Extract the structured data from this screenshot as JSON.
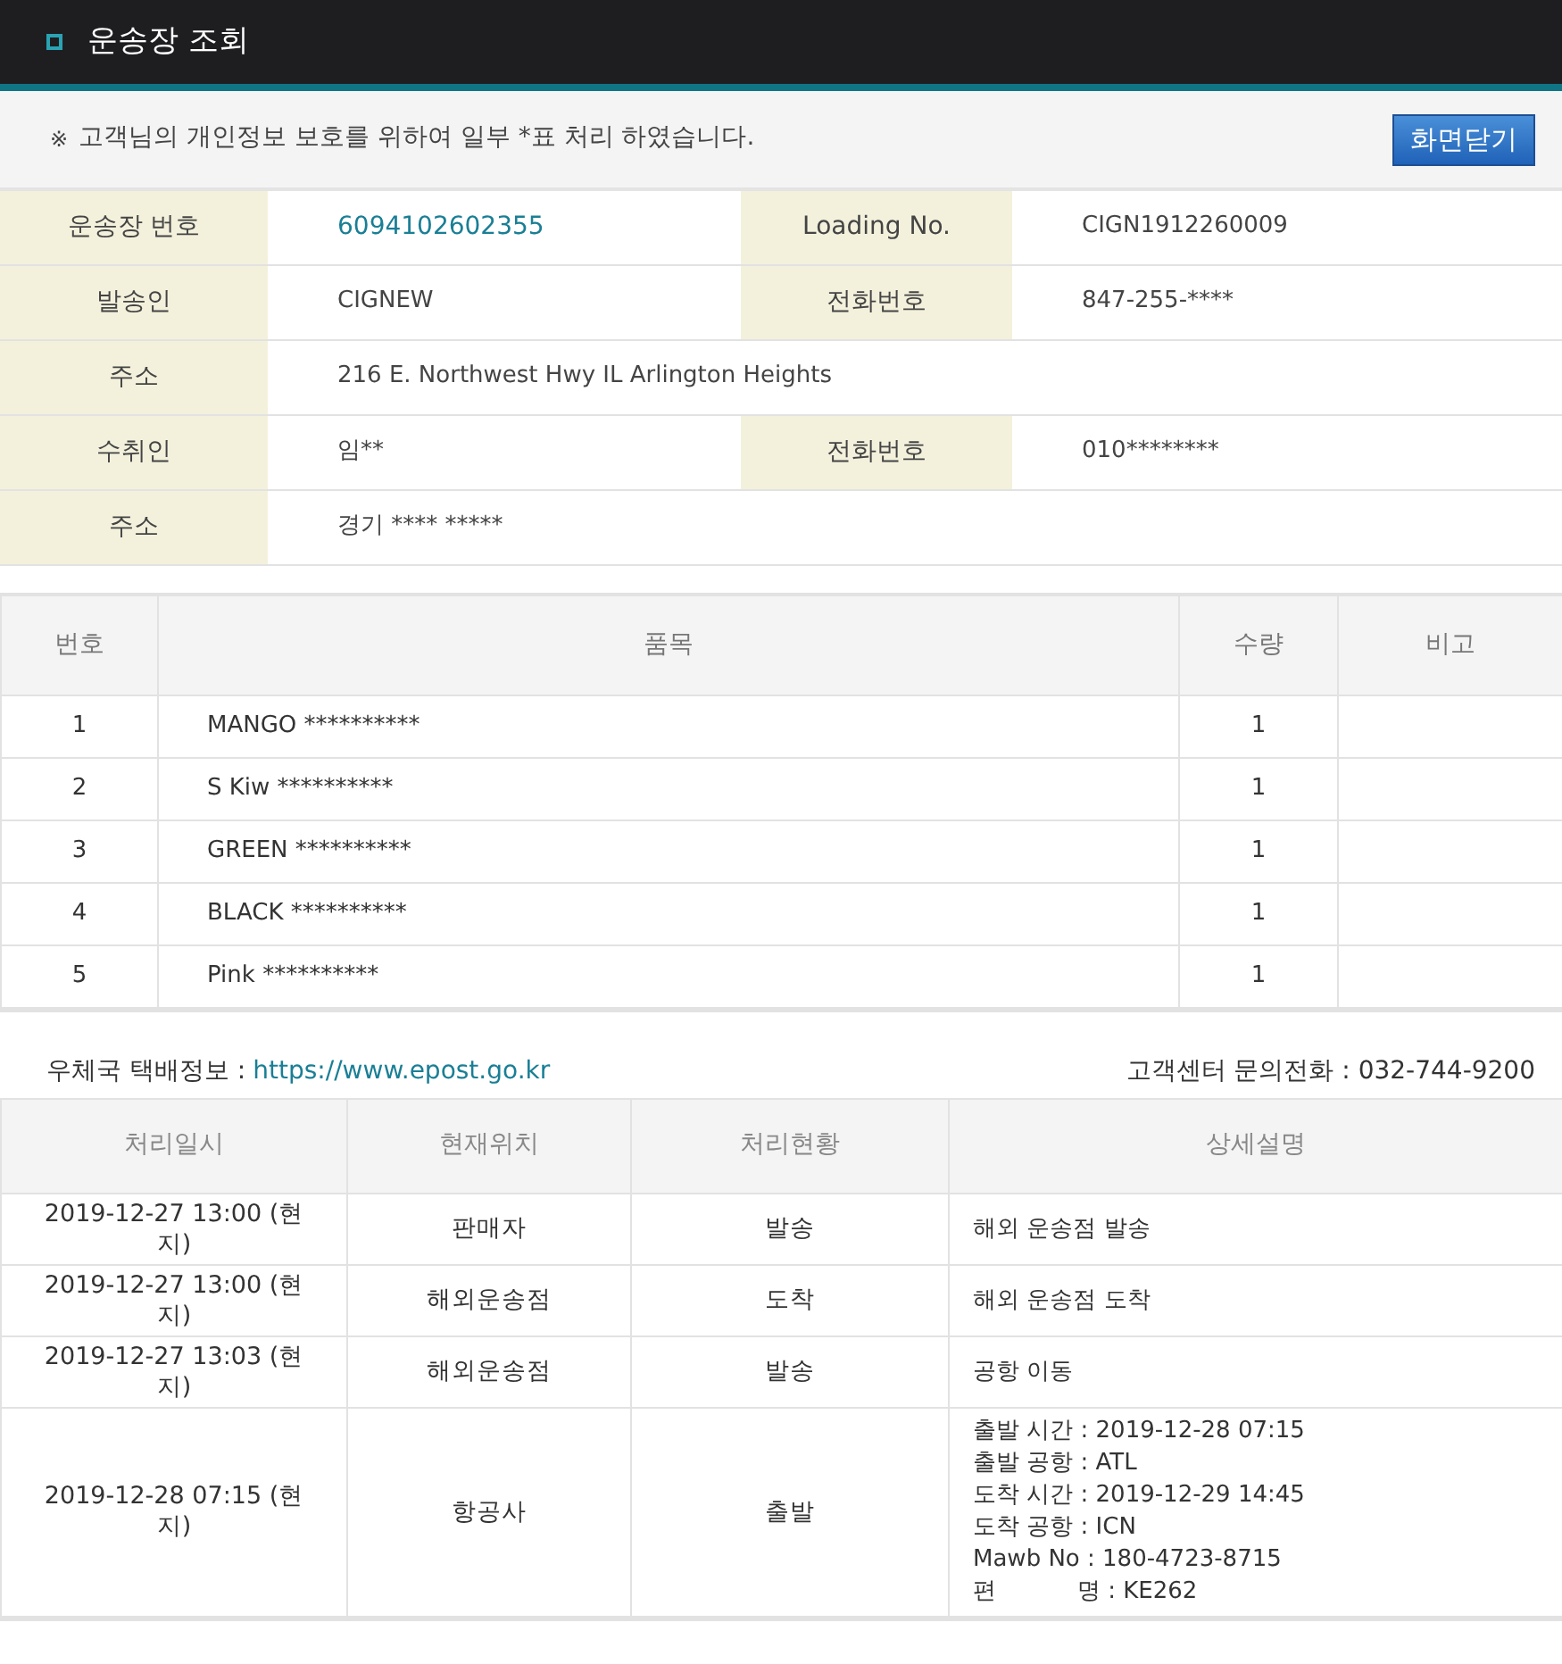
{
  "header": {
    "title": "운송장 조회"
  },
  "notice": {
    "mark": "※",
    "text": "고객님의 개인정보 보호를 위하여 일부 *표 처리 하였습니다.",
    "close_button": "화면닫기"
  },
  "info_rows": [
    {
      "cells": [
        {
          "label": "운송장 번호",
          "value": "6094102602355",
          "kind": "link"
        },
        {
          "label": "Loading No.",
          "value": "CIGN1912260009",
          "kind": "text"
        }
      ]
    },
    {
      "cells": [
        {
          "label": "발송인",
          "value": "CIGNEW",
          "kind": "text"
        },
        {
          "label": "전화번호",
          "value": "847-255-****",
          "kind": "text"
        }
      ]
    },
    {
      "cells": [
        {
          "label": "주소",
          "value": "216 E. Northwest Hwy IL Arlington Heights",
          "kind": "text"
        }
      ]
    },
    {
      "cells": [
        {
          "label": "수취인",
          "value": "임**",
          "kind": "text"
        },
        {
          "label": "전화번호",
          "value": "010********",
          "kind": "text"
        }
      ]
    },
    {
      "cells": [
        {
          "label": "주소",
          "value": "경기 **** *****",
          "kind": "text"
        }
      ]
    }
  ],
  "items_table": {
    "columns": [
      "번호",
      "품목",
      "수량",
      "비고"
    ],
    "rows": [
      [
        "1",
        "MANGO **********",
        "1"
      ],
      [
        "2",
        "S Kiw **********",
        "1"
      ],
      [
        "3",
        "GREEN **********",
        "1"
      ],
      [
        "4",
        "BLACK **********",
        "1"
      ],
      [
        "5",
        "Pink **********",
        "1"
      ]
    ]
  },
  "links": {
    "label": "우체국 택배정보 :",
    "url": "https://www.epost.go.kr",
    "contact": "고객센터 문의전화 : 032-744-9200"
  },
  "tracking_table": {
    "columns": [
      "처리일시",
      "현재위치",
      "처리현황",
      "상세설명"
    ],
    "rows": [
      {
        "time": "2019-12-27 13:00 (현지)",
        "location": "판매자",
        "status": "발송",
        "details": [
          "해외 운송점 발송"
        ]
      },
      {
        "time": "2019-12-27 13:00 (현지)",
        "location": "해외운송점",
        "status": "도착",
        "details": [
          "해외 운송점 도착"
        ]
      },
      {
        "time": "2019-12-27 13:03 (현지)",
        "location": "해외운송점",
        "status": "발송",
        "details": [
          "공항 이동"
        ]
      },
      {
        "time": "2019-12-28 07:15 (현지)",
        "location": "항공사",
        "status": "출발",
        "details": [
          "출발 시간 : 2019-12-28 07:15",
          "출발 공항 : ATL",
          "도착 시간 : 2019-12-29 14:45",
          "도착 공항 : ICN",
          "Mawb No : 180-4723-8715",
          "편           명 : KE262"
        ]
      }
    ]
  }
}
